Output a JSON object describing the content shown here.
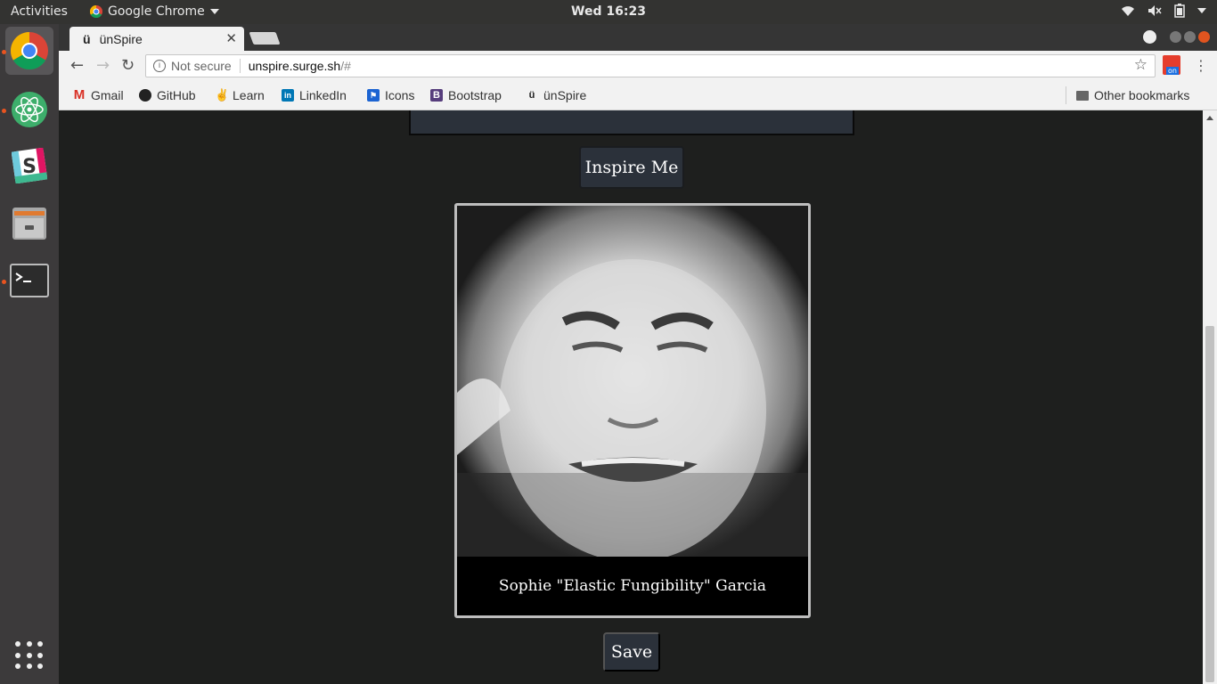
{
  "topbar": {
    "activities": "Activities",
    "app_name": "Google Chrome",
    "clock": "Wed 16:23"
  },
  "browser": {
    "tab_title": "ünSpire",
    "tab_favicon": "ü",
    "not_secure": "Not secure",
    "url_host": "unspire.surge.sh",
    "url_path": "/#",
    "ext_badge": "on"
  },
  "bookmarks": {
    "items": [
      {
        "label": "Gmail",
        "icon": "gmail-icon"
      },
      {
        "label": "GitHub",
        "icon": "github-icon"
      },
      {
        "label": "Learn",
        "icon": "learn-icon"
      },
      {
        "label": "LinkedIn",
        "icon": "linkedin-icon"
      },
      {
        "label": "Icons",
        "icon": "flag-icon"
      },
      {
        "label": "Bootstrap",
        "icon": "bootstrap-icon"
      },
      {
        "label": "ünSpire",
        "icon": "unspire-icon"
      }
    ],
    "other": "Other bookmarks"
  },
  "page": {
    "inspire_button": "Inspire Me",
    "caption": "Sophie \"Elastic Fungibility\" Garcia",
    "save_button": "Save"
  },
  "colors": {
    "page_bg": "#1e1f1e",
    "button_bg": "#2b313a",
    "accent": "#e95420"
  }
}
